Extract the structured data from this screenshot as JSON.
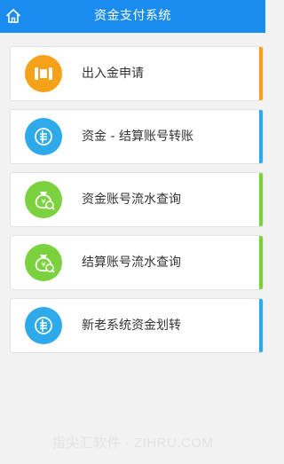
{
  "header": {
    "title": "资金支付系统",
    "background": "#1a8cf0",
    "home_icon": "home-icon"
  },
  "menu": [
    {
      "id": "deposit-withdraw-application",
      "label": "出入金申请",
      "icon": "card-icon",
      "icon_color": "#f5a21a",
      "bar_color": "#f5a21a"
    },
    {
      "id": "fund-settlement-transfer",
      "label": "资金 - 结算账号转账",
      "icon": "transfer-icon",
      "icon_color": "#2ea9ea",
      "bar_color": "#2ea9ea"
    },
    {
      "id": "fund-account-statement-query",
      "label": "资金账号流水查询",
      "icon": "money-bag-search-icon",
      "icon_color": "#7bd23e",
      "bar_color": "#7bd23e"
    },
    {
      "id": "settlement-account-statement-query",
      "label": "结算账号流水查询",
      "icon": "money-bag-search-icon",
      "icon_color": "#7bd23e",
      "bar_color": "#7bd23e"
    },
    {
      "id": "old-new-system-fund-transfer",
      "label": "新老系统资金划转",
      "icon": "transfer-icon",
      "icon_color": "#2ea9ea",
      "bar_color": "#2ea9ea"
    }
  ],
  "watermark": "指尖汇软件 · ZIHRU.COM"
}
